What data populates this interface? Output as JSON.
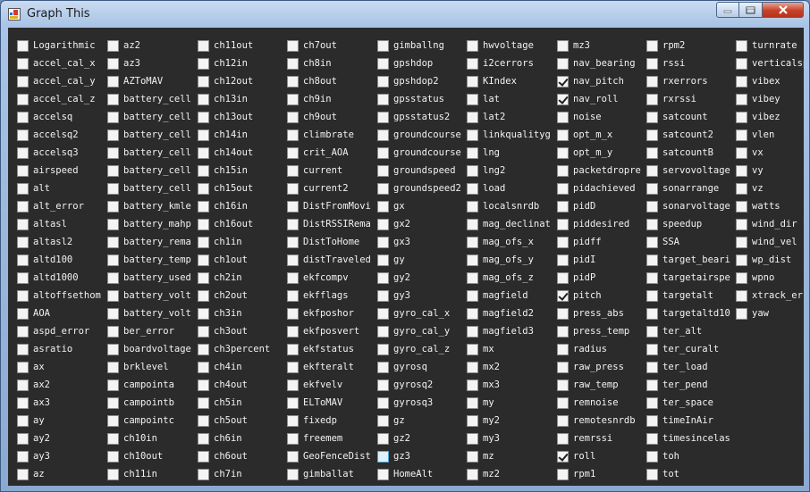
{
  "window": {
    "title": "Graph This"
  },
  "columns": [
    {
      "items": [
        {
          "label": "Logarithmic",
          "checked": false
        },
        {
          "label": "accel_cal_x",
          "checked": false
        },
        {
          "label": "accel_cal_y",
          "checked": false
        },
        {
          "label": "accel_cal_z",
          "checked": false
        },
        {
          "label": "accelsq",
          "checked": false
        },
        {
          "label": "accelsq2",
          "checked": false
        },
        {
          "label": "accelsq3",
          "checked": false
        },
        {
          "label": "airspeed",
          "checked": false
        },
        {
          "label": "alt",
          "checked": false
        },
        {
          "label": "alt_error",
          "checked": false
        },
        {
          "label": "altasl",
          "checked": false
        },
        {
          "label": "altasl2",
          "checked": false
        },
        {
          "label": "altd100",
          "checked": false
        },
        {
          "label": "altd1000",
          "checked": false
        },
        {
          "label": "altoffsethom",
          "checked": false
        },
        {
          "label": "AOA",
          "checked": false
        },
        {
          "label": "aspd_error",
          "checked": false
        },
        {
          "label": "asratio",
          "checked": false
        },
        {
          "label": "ax",
          "checked": false
        },
        {
          "label": "ax2",
          "checked": false
        },
        {
          "label": "ax3",
          "checked": false
        },
        {
          "label": "ay",
          "checked": false
        },
        {
          "label": "ay2",
          "checked": false
        },
        {
          "label": "ay3",
          "checked": false
        },
        {
          "label": "az",
          "checked": false
        }
      ]
    },
    {
      "items": [
        {
          "label": "az2",
          "checked": false
        },
        {
          "label": "az3",
          "checked": false
        },
        {
          "label": "AZToMAV",
          "checked": false
        },
        {
          "label": "battery_cell",
          "checked": false
        },
        {
          "label": "battery_cell",
          "checked": false
        },
        {
          "label": "battery_cell",
          "checked": false
        },
        {
          "label": "battery_cell",
          "checked": false
        },
        {
          "label": "battery_cell",
          "checked": false
        },
        {
          "label": "battery_cell",
          "checked": false
        },
        {
          "label": "battery_kmle",
          "checked": false
        },
        {
          "label": "battery_mahp",
          "checked": false
        },
        {
          "label": "battery_rema",
          "checked": false
        },
        {
          "label": "battery_temp",
          "checked": false
        },
        {
          "label": "battery_used",
          "checked": false
        },
        {
          "label": "battery_volt",
          "checked": false
        },
        {
          "label": "battery_volt",
          "checked": false
        },
        {
          "label": "ber_error",
          "checked": false
        },
        {
          "label": "boardvoltage",
          "checked": false
        },
        {
          "label": "brklevel",
          "checked": false
        },
        {
          "label": "campointa",
          "checked": false
        },
        {
          "label": "campointb",
          "checked": false
        },
        {
          "label": "campointc",
          "checked": false
        },
        {
          "label": "ch10in",
          "checked": false
        },
        {
          "label": "ch10out",
          "checked": false
        },
        {
          "label": "ch11in",
          "checked": false
        }
      ]
    },
    {
      "items": [
        {
          "label": "ch11out",
          "checked": false
        },
        {
          "label": "ch12in",
          "checked": false
        },
        {
          "label": "ch12out",
          "checked": false
        },
        {
          "label": "ch13in",
          "checked": false
        },
        {
          "label": "ch13out",
          "checked": false
        },
        {
          "label": "ch14in",
          "checked": false
        },
        {
          "label": "ch14out",
          "checked": false
        },
        {
          "label": "ch15in",
          "checked": false
        },
        {
          "label": "ch15out",
          "checked": false
        },
        {
          "label": "ch16in",
          "checked": false
        },
        {
          "label": "ch16out",
          "checked": false
        },
        {
          "label": "ch1in",
          "checked": false
        },
        {
          "label": "ch1out",
          "checked": false
        },
        {
          "label": "ch2in",
          "checked": false
        },
        {
          "label": "ch2out",
          "checked": false
        },
        {
          "label": "ch3in",
          "checked": false
        },
        {
          "label": "ch3out",
          "checked": false
        },
        {
          "label": "ch3percent",
          "checked": false
        },
        {
          "label": "ch4in",
          "checked": false
        },
        {
          "label": "ch4out",
          "checked": false
        },
        {
          "label": "ch5in",
          "checked": false
        },
        {
          "label": "ch5out",
          "checked": false
        },
        {
          "label": "ch6in",
          "checked": false
        },
        {
          "label": "ch6out",
          "checked": false
        },
        {
          "label": "ch7in",
          "checked": false
        }
      ]
    },
    {
      "items": [
        {
          "label": "ch7out",
          "checked": false
        },
        {
          "label": "ch8in",
          "checked": false
        },
        {
          "label": "ch8out",
          "checked": false
        },
        {
          "label": "ch9in",
          "checked": false
        },
        {
          "label": "ch9out",
          "checked": false
        },
        {
          "label": "climbrate",
          "checked": false
        },
        {
          "label": "crit_AOA",
          "checked": false
        },
        {
          "label": "current",
          "checked": false
        },
        {
          "label": "current2",
          "checked": false
        },
        {
          "label": "DistFromMovi",
          "checked": false
        },
        {
          "label": "DistRSSIRema",
          "checked": false
        },
        {
          "label": "DistToHome",
          "checked": false
        },
        {
          "label": "distTraveled",
          "checked": false
        },
        {
          "label": "ekfcompv",
          "checked": false
        },
        {
          "label": "ekfflags",
          "checked": false
        },
        {
          "label": "ekfposhor",
          "checked": false
        },
        {
          "label": "ekfposvert",
          "checked": false
        },
        {
          "label": "ekfstatus",
          "checked": false
        },
        {
          "label": "ekfteralt",
          "checked": false
        },
        {
          "label": "ekfvelv",
          "checked": false
        },
        {
          "label": "ELToMAV",
          "checked": false
        },
        {
          "label": "fixedp",
          "checked": false
        },
        {
          "label": "freemem",
          "checked": false
        },
        {
          "label": "GeoFenceDist",
          "checked": false
        },
        {
          "label": "gimballat",
          "checked": false
        }
      ]
    },
    {
      "items": [
        {
          "label": "gimballng",
          "checked": false
        },
        {
          "label": "gpshdop",
          "checked": false
        },
        {
          "label": "gpshdop2",
          "checked": false
        },
        {
          "label": "gpsstatus",
          "checked": false
        },
        {
          "label": "gpsstatus2",
          "checked": false
        },
        {
          "label": "groundcourse",
          "checked": false
        },
        {
          "label": "groundcourse",
          "checked": false
        },
        {
          "label": "groundspeed",
          "checked": false
        },
        {
          "label": "groundspeed2",
          "checked": false
        },
        {
          "label": "gx",
          "checked": false
        },
        {
          "label": "gx2",
          "checked": false
        },
        {
          "label": "gx3",
          "checked": false
        },
        {
          "label": "gy",
          "checked": false
        },
        {
          "label": "gy2",
          "checked": false
        },
        {
          "label": "gy3",
          "checked": false
        },
        {
          "label": "gyro_cal_x",
          "checked": false
        },
        {
          "label": "gyro_cal_y",
          "checked": false
        },
        {
          "label": "gyro_cal_z",
          "checked": false
        },
        {
          "label": "gyrosq",
          "checked": false
        },
        {
          "label": "gyrosq2",
          "checked": false
        },
        {
          "label": "gyrosq3",
          "checked": false
        },
        {
          "label": "gz",
          "checked": false
        },
        {
          "label": "gz2",
          "checked": false
        },
        {
          "label": "gz3",
          "checked": false,
          "highlight": true
        },
        {
          "label": "HomeAlt",
          "checked": false
        }
      ]
    },
    {
      "items": [
        {
          "label": "hwvoltage",
          "checked": false
        },
        {
          "label": "i2cerrors",
          "checked": false
        },
        {
          "label": "KIndex",
          "checked": false
        },
        {
          "label": "lat",
          "checked": false
        },
        {
          "label": "lat2",
          "checked": false
        },
        {
          "label": "linkqualityg",
          "checked": false
        },
        {
          "label": "lng",
          "checked": false
        },
        {
          "label": "lng2",
          "checked": false
        },
        {
          "label": "load",
          "checked": false
        },
        {
          "label": "localsnrdb",
          "checked": false
        },
        {
          "label": "mag_declinat",
          "checked": false
        },
        {
          "label": "mag_ofs_x",
          "checked": false
        },
        {
          "label": "mag_ofs_y",
          "checked": false
        },
        {
          "label": "mag_ofs_z",
          "checked": false
        },
        {
          "label": "magfield",
          "checked": false
        },
        {
          "label": "magfield2",
          "checked": false
        },
        {
          "label": "magfield3",
          "checked": false
        },
        {
          "label": "mx",
          "checked": false
        },
        {
          "label": "mx2",
          "checked": false
        },
        {
          "label": "mx3",
          "checked": false
        },
        {
          "label": "my",
          "checked": false
        },
        {
          "label": "my2",
          "checked": false
        },
        {
          "label": "my3",
          "checked": false
        },
        {
          "label": "mz",
          "checked": false
        },
        {
          "label": "mz2",
          "checked": false
        }
      ]
    },
    {
      "items": [
        {
          "label": "mz3",
          "checked": false
        },
        {
          "label": "nav_bearing",
          "checked": false
        },
        {
          "label": "nav_pitch",
          "checked": true
        },
        {
          "label": "nav_roll",
          "checked": true
        },
        {
          "label": "noise",
          "checked": false
        },
        {
          "label": "opt_m_x",
          "checked": false
        },
        {
          "label": "opt_m_y",
          "checked": false
        },
        {
          "label": "packetdropre",
          "checked": false
        },
        {
          "label": "pidachieved",
          "checked": false
        },
        {
          "label": "pidD",
          "checked": false
        },
        {
          "label": "piddesired",
          "checked": false
        },
        {
          "label": "pidff",
          "checked": false
        },
        {
          "label": "pidI",
          "checked": false
        },
        {
          "label": "pidP",
          "checked": false
        },
        {
          "label": "pitch",
          "checked": true
        },
        {
          "label": "press_abs",
          "checked": false
        },
        {
          "label": "press_temp",
          "checked": false
        },
        {
          "label": "radius",
          "checked": false
        },
        {
          "label": "raw_press",
          "checked": false
        },
        {
          "label": "raw_temp",
          "checked": false
        },
        {
          "label": "remnoise",
          "checked": false
        },
        {
          "label": "remotesnrdb",
          "checked": false
        },
        {
          "label": "remrssi",
          "checked": false
        },
        {
          "label": "roll",
          "checked": true
        },
        {
          "label": "rpm1",
          "checked": false
        }
      ]
    },
    {
      "items": [
        {
          "label": "rpm2",
          "checked": false
        },
        {
          "label": "rssi",
          "checked": false
        },
        {
          "label": "rxerrors",
          "checked": false
        },
        {
          "label": "rxrssi",
          "checked": false
        },
        {
          "label": "satcount",
          "checked": false
        },
        {
          "label": "satcount2",
          "checked": false
        },
        {
          "label": "satcountB",
          "checked": false
        },
        {
          "label": "servovoltage",
          "checked": false
        },
        {
          "label": "sonarrange",
          "checked": false
        },
        {
          "label": "sonarvoltage",
          "checked": false
        },
        {
          "label": "speedup",
          "checked": false
        },
        {
          "label": "SSA",
          "checked": false
        },
        {
          "label": "target_beari",
          "checked": false
        },
        {
          "label": "targetairspe",
          "checked": false
        },
        {
          "label": "targetalt",
          "checked": false
        },
        {
          "label": "targetaltd10",
          "checked": false
        },
        {
          "label": "ter_alt",
          "checked": false
        },
        {
          "label": "ter_curalt",
          "checked": false
        },
        {
          "label": "ter_load",
          "checked": false
        },
        {
          "label": "ter_pend",
          "checked": false
        },
        {
          "label": "ter_space",
          "checked": false
        },
        {
          "label": "timeInAir",
          "checked": false
        },
        {
          "label": "timesincelas",
          "checked": false
        },
        {
          "label": "toh",
          "checked": false
        },
        {
          "label": "tot",
          "checked": false
        }
      ]
    },
    {
      "items": [
        {
          "label": "turnrate",
          "checked": false
        },
        {
          "label": "verticalspe",
          "checked": false
        },
        {
          "label": "vibex",
          "checked": false
        },
        {
          "label": "vibey",
          "checked": false
        },
        {
          "label": "vibez",
          "checked": false
        },
        {
          "label": "vlen",
          "checked": false
        },
        {
          "label": "vx",
          "checked": false
        },
        {
          "label": "vy",
          "checked": false
        },
        {
          "label": "vz",
          "checked": false
        },
        {
          "label": "watts",
          "checked": false
        },
        {
          "label": "wind_dir",
          "checked": false
        },
        {
          "label": "wind_vel",
          "checked": false
        },
        {
          "label": "wp_dist",
          "checked": false
        },
        {
          "label": "wpno",
          "checked": false
        },
        {
          "label": "xtrack_erro",
          "checked": false
        },
        {
          "label": "yaw",
          "checked": false
        }
      ]
    }
  ]
}
